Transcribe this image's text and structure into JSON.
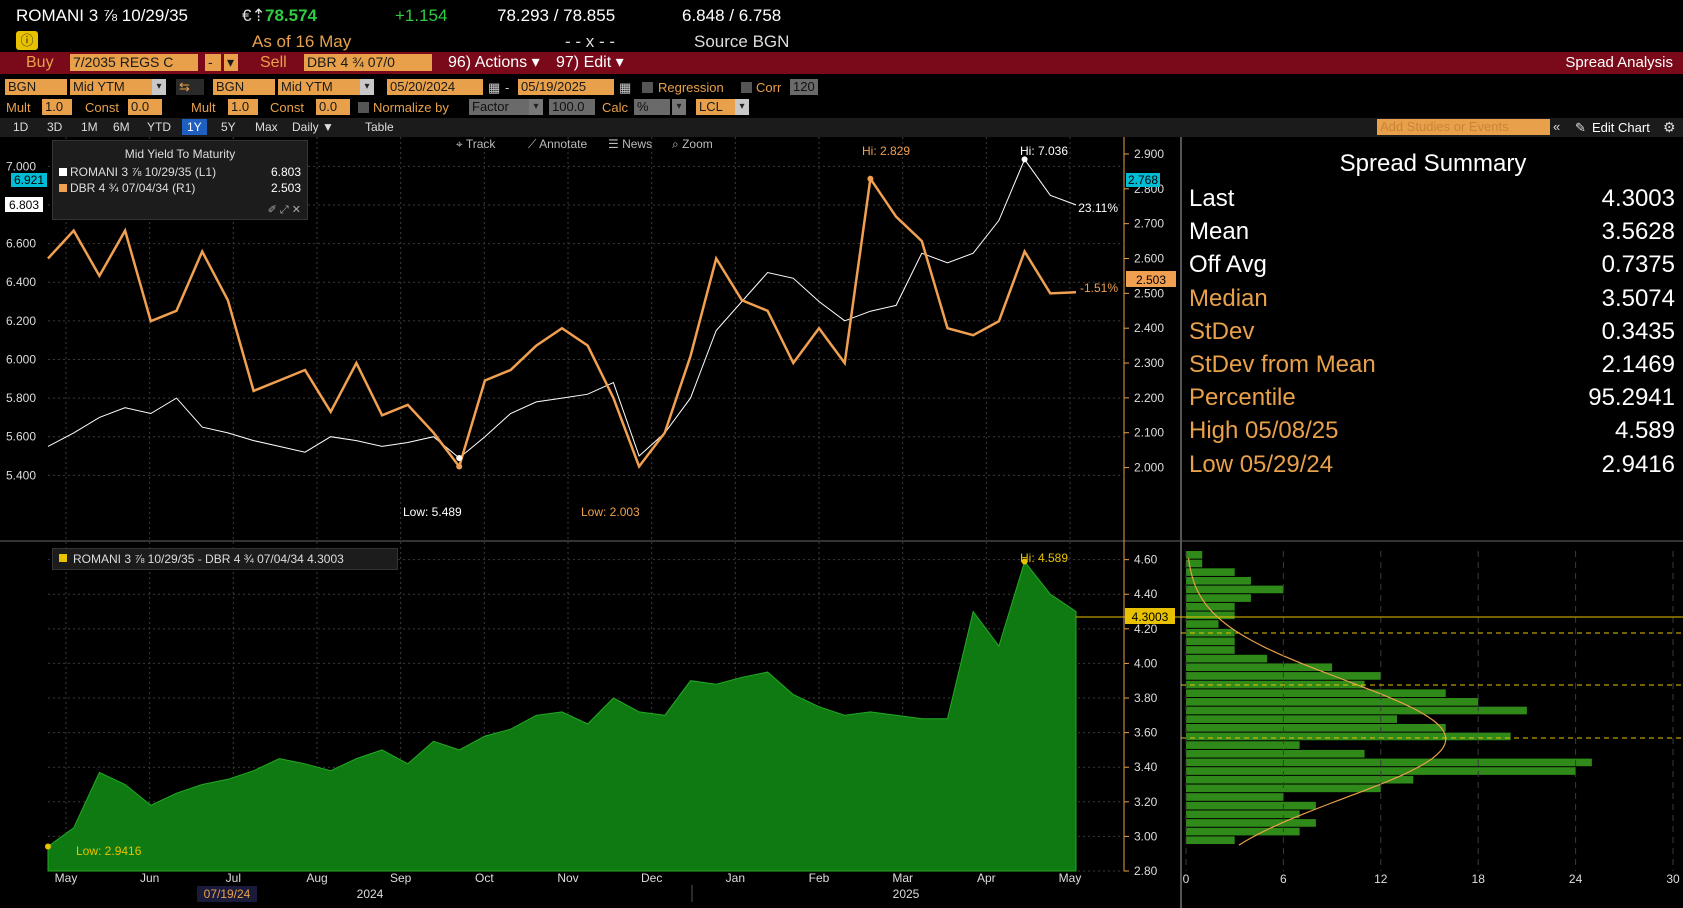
{
  "header": {
    "security": "ROMANI 3 ⅞ 10/29/35",
    "price_prefix": "€⇡",
    "price": "78.574",
    "change": "+1.154",
    "bid_ask": "78.293 / 78.855",
    "yields": "6.848 / 6.758",
    "as_of": "As of  16 May",
    "ticks": "- - x - -",
    "source": "Source  BGN"
  },
  "command_bar": {
    "buy_label": "Buy",
    "buy_value": "7/2035 REGS C",
    "sell_label": "Sell",
    "sell_value": "DBR 4 ¾ 07/0",
    "actions": "96) Actions ▾",
    "edit": "97) Edit ▾",
    "title": "Spread Analysis"
  },
  "settings": {
    "src1": "BGN",
    "field1": "Mid YTM",
    "src2": "BGN",
    "field2": "Mid YTM",
    "start_date": "05/20/2024",
    "end_date": "05/19/2025",
    "regression": "Regression",
    "corr": "Corr",
    "corr_value": "120",
    "mult1_label": "Mult",
    "mult1": "1.0",
    "const1_label": "Const",
    "const1": "0.0",
    "mult2_label": "Mult",
    "mult2": "1.0",
    "const2_label": "Const",
    "const2": "0.0",
    "normalize_label": "Normalize by",
    "normalize": "Factor",
    "normalize_value": "100.0",
    "calc_label": "Calc",
    "calc": "%",
    "lcl": "LCL"
  },
  "ranges": [
    "1D",
    "3D",
    "1M",
    "6M",
    "YTD",
    "1Y",
    "5Y",
    "Max",
    "Daily ▼",
    "Table"
  ],
  "range_selected": "1Y",
  "studies_placeholder": "Add Studies or Events",
  "edit_chart": "Edit Chart",
  "chart_tools": [
    "Track",
    "Annotate",
    "News",
    "Zoom"
  ],
  "upper_chart": {
    "legend_title": "Mid Yield To Maturity",
    "series": [
      {
        "name": "ROMANI 3 ⅞ 10/29/35  (L1)",
        "last": "6.803",
        "color": "#ffffff"
      },
      {
        "name": "DBR 4 ¾ 07/04/34  (R1)",
        "last": "2.503",
        "color": "#f0a050"
      }
    ],
    "left_ticks": [
      "7.000",
      "6.800",
      "6.600",
      "6.400",
      "6.200",
      "6.000",
      "5.800",
      "5.600",
      "5.400"
    ],
    "right_ticks": [
      "2.900",
      "2.800",
      "2.700",
      "2.600",
      "2.500",
      "2.400",
      "2.300",
      "2.200",
      "2.100",
      "2.000"
    ],
    "tag_left_prev": "6.921",
    "tag_left_last": "6.803",
    "tag_right_prev": "2.768",
    "tag_right_last": "2.503",
    "pct_white": "23.11%",
    "pct_orange": "-1.51%",
    "hi_orange": "Hi: 2.829",
    "hi_white": "Hi: 7.036",
    "low_white": "Low: 5.489",
    "low_orange": "Low: 2.003"
  },
  "lower_chart": {
    "legend": "ROMANI 3 ⅞ 10/29/35 - DBR 4 ¾ 07/04/34 4.3003",
    "ticks": [
      "4.60",
      "4.40",
      "4.20",
      "4.00",
      "3.80",
      "3.60",
      "3.40",
      "3.20",
      "3.00",
      "2.80"
    ],
    "last_tag": "4.3003",
    "hi": "Hi: 4.589",
    "low": "Low: 2.9416",
    "hist_ticks": [
      "0",
      "6",
      "12",
      "18",
      "24",
      "30"
    ]
  },
  "x_axis": {
    "months": [
      "May",
      "Jun",
      "Jul",
      "Aug",
      "Sep",
      "Oct",
      "Nov",
      "Dec",
      "Jan",
      "Feb",
      "Mar",
      "Apr",
      "May"
    ],
    "years": [
      "2024",
      "2025"
    ],
    "cursor_date": "07/19/24"
  },
  "summary": {
    "title": "Spread Summary",
    "rows": [
      {
        "k": "Last",
        "v": "4.3003"
      },
      {
        "k": "Mean",
        "v": "3.5628"
      },
      {
        "k": "Off Avg",
        "v": "0.7375"
      },
      {
        "k": "Median",
        "v": "3.5074"
      },
      {
        "k": "StDev",
        "v": "0.3435"
      },
      {
        "k": "StDev from Mean",
        "v": "2.1469"
      },
      {
        "k": "Percentile",
        "v": "95.2941"
      },
      {
        "k": "High 05/08/25",
        "v": "4.589"
      },
      {
        "k": "Low 05/29/24",
        "v": "2.9416"
      }
    ]
  },
  "chart_data": {
    "type": "line",
    "x_range": [
      "2024-05-20",
      "2025-05-19"
    ],
    "series": [
      {
        "name": "ROMANI 3 ⅞ 10/29/35  (L1)",
        "axis": "left",
        "ylim": [
          5.35,
          7.1
        ],
        "values": [
          5.55,
          5.62,
          5.7,
          5.75,
          5.72,
          5.8,
          5.65,
          5.62,
          5.58,
          5.55,
          5.52,
          5.6,
          5.58,
          5.55,
          5.57,
          5.6,
          5.49,
          5.6,
          5.72,
          5.78,
          5.8,
          5.82,
          5.88,
          5.5,
          5.62,
          5.8,
          6.15,
          6.3,
          6.45,
          6.42,
          6.3,
          6.2,
          6.25,
          6.28,
          6.55,
          6.5,
          6.55,
          6.72,
          7.036,
          6.85,
          6.8
        ],
        "color": "#ffffff"
      },
      {
        "name": "DBR 4 ¾ 07/04/34  (R1)",
        "axis": "right",
        "ylim": [
          1.95,
          2.92
        ],
        "values": [
          2.6,
          2.68,
          2.55,
          2.68,
          2.42,
          2.45,
          2.62,
          2.48,
          2.22,
          2.25,
          2.28,
          2.16,
          2.3,
          2.15,
          2.18,
          2.1,
          2.003,
          2.25,
          2.28,
          2.35,
          2.4,
          2.35,
          2.2,
          2.003,
          2.1,
          2.32,
          2.6,
          2.48,
          2.45,
          2.3,
          2.4,
          2.3,
          2.829,
          2.72,
          2.65,
          2.4,
          2.38,
          2.42,
          2.62,
          2.5,
          2.503
        ],
        "color": "#f0a050"
      },
      {
        "name": "ROMANI 3 ⅞ 10/29/35 - DBR 4 ¾ 07/04/34",
        "axis": "lower",
        "ylim": [
          2.8,
          4.65
        ],
        "values": [
          2.9416,
          3.05,
          3.37,
          3.3,
          3.18,
          3.25,
          3.3,
          3.33,
          3.38,
          3.45,
          3.42,
          3.38,
          3.45,
          3.5,
          3.42,
          3.55,
          3.5,
          3.58,
          3.62,
          3.7,
          3.72,
          3.65,
          3.8,
          3.72,
          3.7,
          3.9,
          3.88,
          3.92,
          3.95,
          3.82,
          3.75,
          3.7,
          3.72,
          3.7,
          3.68,
          3.68,
          4.3,
          4.1,
          4.589,
          4.4,
          4.3003
        ],
        "color": "#1a8a1a"
      }
    ],
    "histogram": {
      "bins": [
        2.95,
        3.0,
        3.05,
        3.1,
        3.15,
        3.2,
        3.25,
        3.3,
        3.35,
        3.4,
        3.45,
        3.5,
        3.55,
        3.6,
        3.65,
        3.7,
        3.75,
        3.8,
        3.85,
        3.9,
        3.95,
        4.0,
        4.05,
        4.1,
        4.15,
        4.2,
        4.25,
        4.3,
        4.35,
        4.4,
        4.45,
        4.5,
        4.55,
        4.6
      ],
      "counts": [
        3,
        7,
        8,
        7,
        8,
        6,
        12,
        14,
        24,
        25,
        11,
        7,
        20,
        16,
        13,
        21,
        18,
        16,
        11,
        12,
        9,
        5,
        3,
        3,
        3,
        2,
        3,
        3,
        4,
        6,
        4,
        3,
        1,
        1
      ]
    }
  }
}
